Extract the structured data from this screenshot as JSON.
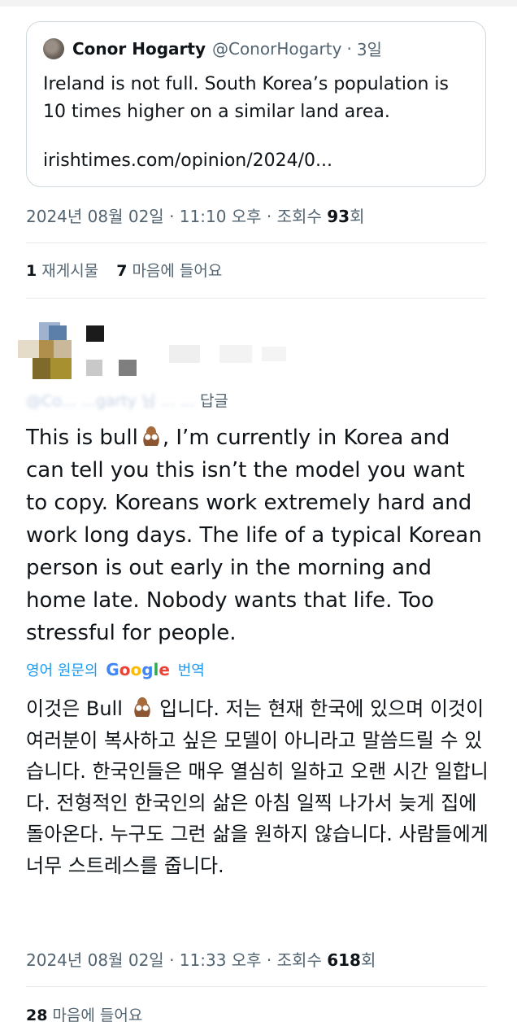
{
  "quoted_tweet": {
    "author_name": "Conor Hogarty",
    "author_handle": "@ConorHogarty",
    "separator": "·",
    "age": "3일",
    "text": "Ireland is not full. South Korea’s population is\n10 times higher on a similar land area.",
    "link": "irishtimes.com/opinion/2024/0..."
  },
  "main_meta": {
    "date_time": "2024년 08월 02일 · 11:10 오후 · 조회수",
    "views_number": "93",
    "views_suffix": "회"
  },
  "main_stats": {
    "reposts_count": "1",
    "reposts_label": "재게시물",
    "likes_count": "7",
    "likes_label": "마음에 들어요"
  },
  "reply": {
    "reply_to_blurred": "@Co... ...garty 님 ... ...",
    "reply_suffix": "답글",
    "text_before_emoji": "This is bull",
    "text_after_emoji": ", I’m currently in Korea and can tell you this isn’t the model you want to copy. Koreans work extremely hard and work long days. The life of a typical Korean person is out early in the morning and home late. Nobody wants that life. Too stressful for people.",
    "translate_prefix": "영어 원문의",
    "translate_brand": "Google",
    "translate_suffix": "번역",
    "translated_before_emoji": "이것은 Bull",
    "translated_after_emoji": " 입니다. 저는 현재 한국에 있으며 이것이 여러분이 복사하고 싶은 모델이 아니라고 말씀드릴 수 있습니다. 한국인들은 매우 열심히 일하고 오랜 시간 일합니다. 전형적인 한국인의 삶은 아침 일찍 나가서 늦게 집에 돌아온다. 누구도 그런 삶을 원하지 않습니다. 사람들에게 너무 스트레스를 줍니다.",
    "emoji_icon": "pile-of-poo-emoji"
  },
  "reply_meta": {
    "date_time": "2024년 08월 02일 · 11:33 오후 · 조회수",
    "views_number": "618",
    "views_suffix": "회"
  },
  "reply_stats": {
    "likes_count": "28",
    "likes_label": "마음에 들어요"
  },
  "colors": {
    "text": "#0f1419",
    "secondary": "#536471",
    "link": "#1d9bf0",
    "border": "#cfd9de"
  }
}
